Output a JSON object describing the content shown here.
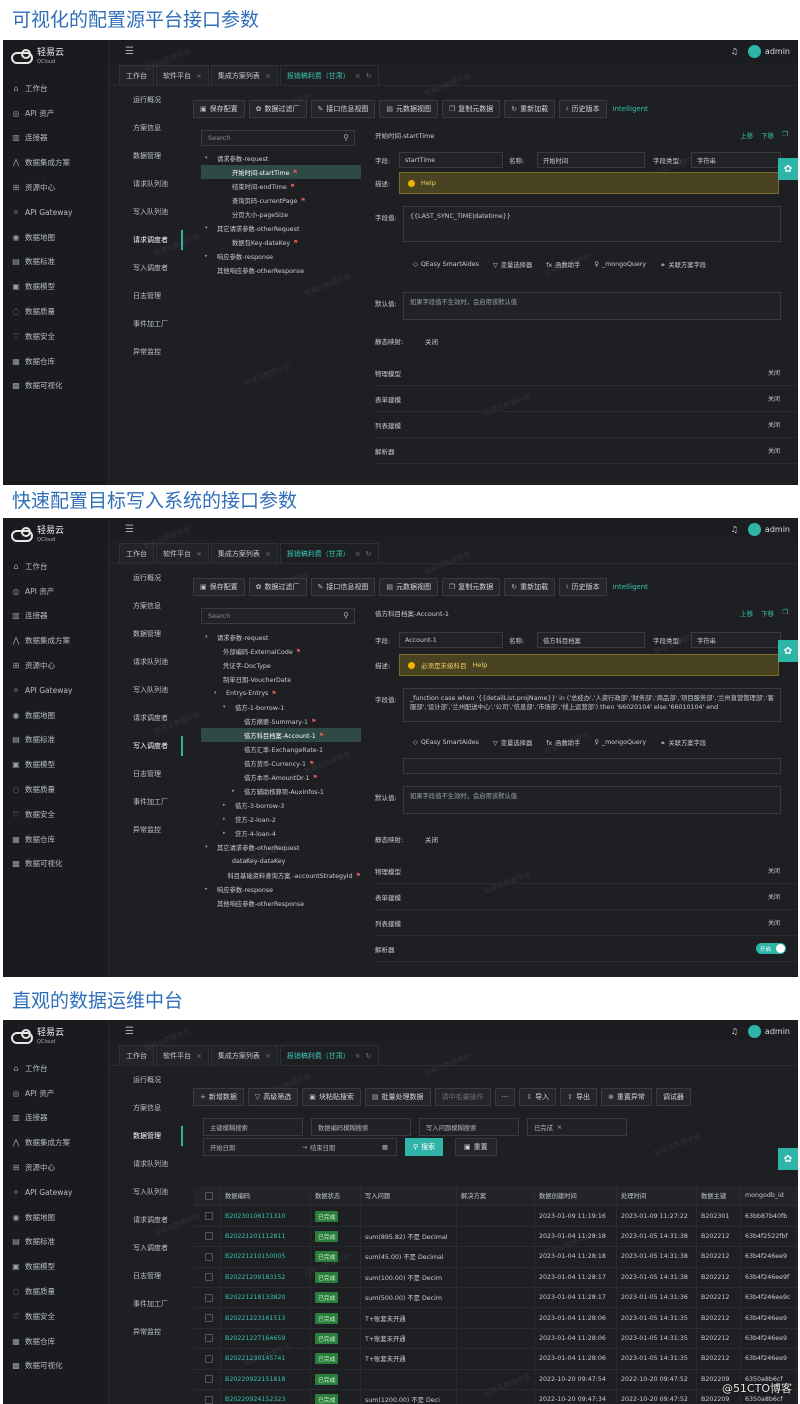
{
  "headings": [
    "可视化的配置源平台接口参数",
    "快速配置目标写入系统的接口参数",
    "直观的数据运维中台"
  ],
  "app": {
    "logo_text": "轻易云",
    "logo_sub": "QCloud",
    "user": "admin",
    "watermark": "轻易云数据中台",
    "sidebar": [
      {
        "icon": "home-icon",
        "glyph": "⌂",
        "label": "工作台"
      },
      {
        "icon": "api-icon",
        "glyph": "◎",
        "label": "API 资产"
      },
      {
        "icon": "connector-icon",
        "glyph": "▥",
        "label": "连接器"
      },
      {
        "icon": "integration-icon",
        "glyph": "⋀",
        "label": "数据集成方案"
      },
      {
        "icon": "resource-icon",
        "glyph": "⊞",
        "label": "资源中心"
      },
      {
        "icon": "gateway-icon",
        "glyph": "✧",
        "label": "API Gateway"
      },
      {
        "icon": "map-icon",
        "glyph": "◉",
        "label": "数据地图"
      },
      {
        "icon": "standard-icon",
        "glyph": "▤",
        "label": "数据标准"
      },
      {
        "icon": "model-icon",
        "glyph": "▣",
        "label": "数据模型"
      },
      {
        "icon": "quality-icon",
        "glyph": "◌",
        "label": "数据质量"
      },
      {
        "icon": "security-icon",
        "glyph": "♡",
        "label": "数据安全"
      },
      {
        "icon": "warehouse-icon",
        "glyph": "▦",
        "label": "数据仓库"
      },
      {
        "icon": "visual-icon",
        "glyph": "▩",
        "label": "数据可视化"
      }
    ],
    "tabs": [
      "工作台",
      "软件平台",
      "集成方案列表",
      "报销稿利费（甘肃）"
    ],
    "subnav": [
      "运行概况",
      "方案信息",
      "数据管理",
      "请求队列池",
      "写入队列池",
      "请求调度者",
      "写入调度者",
      "日志管理",
      "事件加工厂",
      "异常监控"
    ],
    "toolbar": [
      "保存配置",
      "数据过滤厂",
      "接口信息视图",
      "元数据视图",
      "复制元数据",
      "重新加载",
      "历史版本"
    ],
    "toolbar_link": "intelligent",
    "search_placeholder": "Search",
    "nav_up": "上移",
    "nav_down": "下移",
    "labels": {
      "field": "字段:",
      "name": "名称:",
      "type": "字段类型:",
      "desc": "描述:",
      "value": "字段值:",
      "default": "默认值:",
      "static": "静态映射:",
      "help": "Help",
      "static_val": "关闭"
    },
    "helpers": [
      "QEasy SmartAides",
      "变量选择器",
      "函数助手",
      "_mongoQuery",
      "关联方案字段"
    ],
    "default_ph": "如果字段值不生效时，会启用该默认值"
  },
  "panel1": {
    "tree": [
      {
        "d": 0,
        "ar": "▾",
        "ic": "▭",
        "t": "请求参数-request"
      },
      {
        "d": 2,
        "t": "开始时间-startTime",
        "flag": true,
        "sel": true
      },
      {
        "d": 2,
        "t": "结束时间-endTime",
        "flag": true
      },
      {
        "d": 2,
        "t": "查询页码-currentPage",
        "flag": true
      },
      {
        "d": 2,
        "t": "分页大小-pageSize"
      },
      {
        "d": 0,
        "ar": "▾",
        "ic": "▭",
        "t": "其它请求参数-otherRequest"
      },
      {
        "d": 2,
        "t": "数据包Key-dataKey",
        "flag": true
      },
      {
        "d": 0,
        "ar": "▸",
        "ic": "▭",
        "t": "响应参数-response"
      },
      {
        "d": 0,
        "ic": "▭",
        "t": "其他响应参数-otherResponse"
      }
    ],
    "field_title": "开始时间-startTime",
    "field": "startTime",
    "name": "开始时间",
    "type": "字符串",
    "value": "{{LAST_SYNC_TIME|datetime}}",
    "sections": [
      {
        "t": "物理模型",
        "v": "关闭"
      },
      {
        "t": "表单建模",
        "v": "关闭"
      },
      {
        "t": "列表建模",
        "v": "关闭"
      },
      {
        "t": "解析器",
        "v": "关闭"
      }
    ]
  },
  "panel2": {
    "tree": [
      {
        "d": 0,
        "ar": "▾",
        "ic": "▭",
        "t": "请求参数-request"
      },
      {
        "d": 1,
        "t": "外部编码-ExternalCode",
        "flag": true
      },
      {
        "d": 1,
        "t": "凭证字-DocType"
      },
      {
        "d": 1,
        "t": "制单日期-VoucherDate"
      },
      {
        "d": 1,
        "ar": "▾",
        "ic": "▥",
        "t": "Entrys-Entrys",
        "flag": true
      },
      {
        "d": 2,
        "ar": "▾",
        "ic": "⋀",
        "t": "借方-1-borrow-1"
      },
      {
        "d": 3,
        "ic": "▥",
        "t": "借方摘要-Summary-1",
        "flag": true
      },
      {
        "d": 3,
        "ic": "▥",
        "t": "借方科目档案-Account-1",
        "flag": true,
        "sel": true
      },
      {
        "d": 3,
        "ic": "▥",
        "t": "借方汇率-ExchangeRate-1"
      },
      {
        "d": 3,
        "ic": "▥",
        "t": "借方货币-Currency-1",
        "flag": true
      },
      {
        "d": 3,
        "ic": "▥",
        "t": "借方本币-AmountDr-1",
        "flag": true
      },
      {
        "d": 3,
        "ar": "▸",
        "ic": "▥",
        "t": "借方辅助核算项-AuxInfos-1"
      },
      {
        "d": 2,
        "ar": "▸",
        "ic": "⋀",
        "t": "借方-3-borrow-3"
      },
      {
        "d": 2,
        "ar": "▸",
        "ic": "⋀",
        "t": "贷方-2-loan-2"
      },
      {
        "d": 2,
        "ar": "▸",
        "ic": "⋀",
        "t": "贷方-4-loan-4"
      },
      {
        "d": 0,
        "ar": "▾",
        "ic": "▭",
        "t": "其它请求参数-otherRequest"
      },
      {
        "d": 2,
        "t": "dataKey-dataKey"
      },
      {
        "d": 2,
        "t": "科目基础资料查询方案 -accountStrategyId",
        "flag": true
      },
      {
        "d": 0,
        "ar": "▸",
        "ic": "▭",
        "t": "响应参数-response"
      },
      {
        "d": 0,
        "ic": "▭",
        "t": "其他响应参数-otherResponse"
      }
    ],
    "field_title": "借方科目档案-Account-1",
    "field": "Account-1",
    "name": "借方科目档案",
    "type": "字符串",
    "desc": "必须是末级科目",
    "value": "_function case when '{{detailList.projName}}' in ('总经办','人资行政部','财务部','商品部','项目服务部','兰州直营管理部','客服部','设计部','兰州配送中心','公司','信息部','市场部','线上运营部') then '66020104' else '66010104' end",
    "sections": [
      {
        "t": "物理模型",
        "v": "关闭"
      },
      {
        "t": "表单建模",
        "v": "关闭"
      },
      {
        "t": "列表建模",
        "v": "关闭"
      },
      {
        "t": "解析器",
        "v": "开启"
      }
    ]
  },
  "panel3": {
    "toolbar": [
      "新增数据",
      "高级筛选",
      "块粘贴搜索",
      "批量处理数据",
      "请中毛量操作",
      "···",
      "导入",
      "导出",
      "重置异常",
      "调试器"
    ],
    "filters": [
      "主键模糊搜索",
      "数据编码模糊搜索",
      "写入问题模糊搜索",
      "已完成"
    ],
    "start_date": "开始日期",
    "end_date": "结束日期",
    "search": "搜索",
    "reset": "重置",
    "columns": [
      "数据编码",
      "数据状态",
      "写入问题",
      "解决方案",
      "数据创建时间",
      "处理时间",
      "数据主键",
      "mongodb_id"
    ],
    "rows": [
      [
        "B20230106171310",
        "已完成",
        "",
        "",
        "2023-01-09 11:19:16",
        "2023-01-09 11:27:22",
        "B202301",
        "63bb87b40fb"
      ],
      [
        "B20221201112811",
        "已完成",
        "sum(895.82) 不是 Decimal",
        "",
        "2023-01-04 11:28:18",
        "2023-01-05 14:31:38",
        "B202212",
        "63b4f2522fbf"
      ],
      [
        "B20221210150005",
        "已完成",
        "sum(45.00) 不是 Decimal",
        "",
        "2023-01-04 11:28:18",
        "2023-01-05 14:31:38",
        "B202212",
        "63b4f246ee9"
      ],
      [
        "B20221209183152",
        "已完成",
        "sum(100.00) 不是 Decim",
        "",
        "2023-01-04 11:28:17",
        "2023-01-05 14:31:38",
        "B202212",
        "63b4f246ee9f"
      ],
      [
        "B20221218133820",
        "已完成",
        "sum(500.00) 不是 Decim",
        "",
        "2023-01-04 11:28:17",
        "2023-01-05 14:31:36",
        "B202212",
        "63b4f246ee9c"
      ],
      [
        "B20221223161513",
        "已完成",
        "T+账套未开通",
        "",
        "2023-01-04 11:28:06",
        "2023-01-05 14:31:35",
        "B202212",
        "63b4f246ee9"
      ],
      [
        "B20221227164659",
        "已完成",
        "T+账套未开通",
        "",
        "2023-01-04 11:28:06",
        "2023-01-05 14:31:35",
        "B202212",
        "63b4f246ee9"
      ],
      [
        "B20221230145741",
        "已完成",
        "T+账套未开通",
        "",
        "2023-01-04 11:28:06",
        "2023-01-05 14:31:35",
        "B202212",
        "63b4f246ee9"
      ],
      [
        "B20220922151818",
        "已完成",
        "",
        "",
        "2022-10-20 09:47:54",
        "2022-10-20 09:47:52",
        "B202209",
        "6350a8b6cf"
      ],
      [
        "B20220924152323",
        "已完成",
        "sum(1200.00) 不是 Deci",
        "",
        "2022-10-20 09:47:34",
        "2022-10-20 09:47:52",
        "B202209",
        "6350a8b6cf"
      ]
    ],
    "blog_wm": "@51CTO博客"
  }
}
